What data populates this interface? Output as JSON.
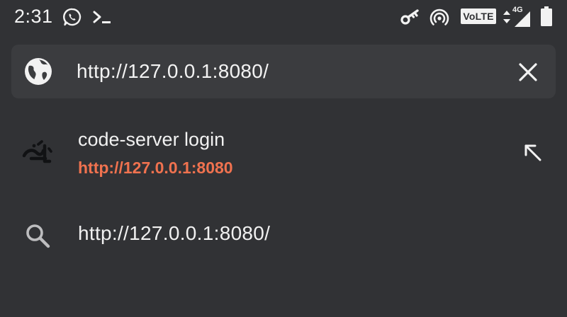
{
  "status_bar": {
    "time": "2:31",
    "icons": [
      "whatsapp-icon",
      "terminal-icon",
      "vpn-key-icon",
      "hotspot-icon",
      "volte-badge",
      "data-arrows-icon",
      "signal-icon",
      "battery-icon"
    ],
    "volte_label": "VoLTE",
    "network_label": "4G"
  },
  "url_bar": {
    "url": "http://127.0.0.1:8080/",
    "site_icon": "globe-icon",
    "clear_icon": "close-icon"
  },
  "suggestions": [
    {
      "icon": "code-server-favicon",
      "title": "code-server login",
      "url": "http://127.0.0.1:8080",
      "action_icon": "arrow-up-left-icon"
    },
    {
      "icon": "search-icon",
      "query": "http://127.0.0.1:8080/"
    }
  ],
  "colors": {
    "background": "#313235",
    "url_bar": "#3b3c3f",
    "text": "#f1f1f1",
    "suggestion_url": "#f0724f"
  }
}
